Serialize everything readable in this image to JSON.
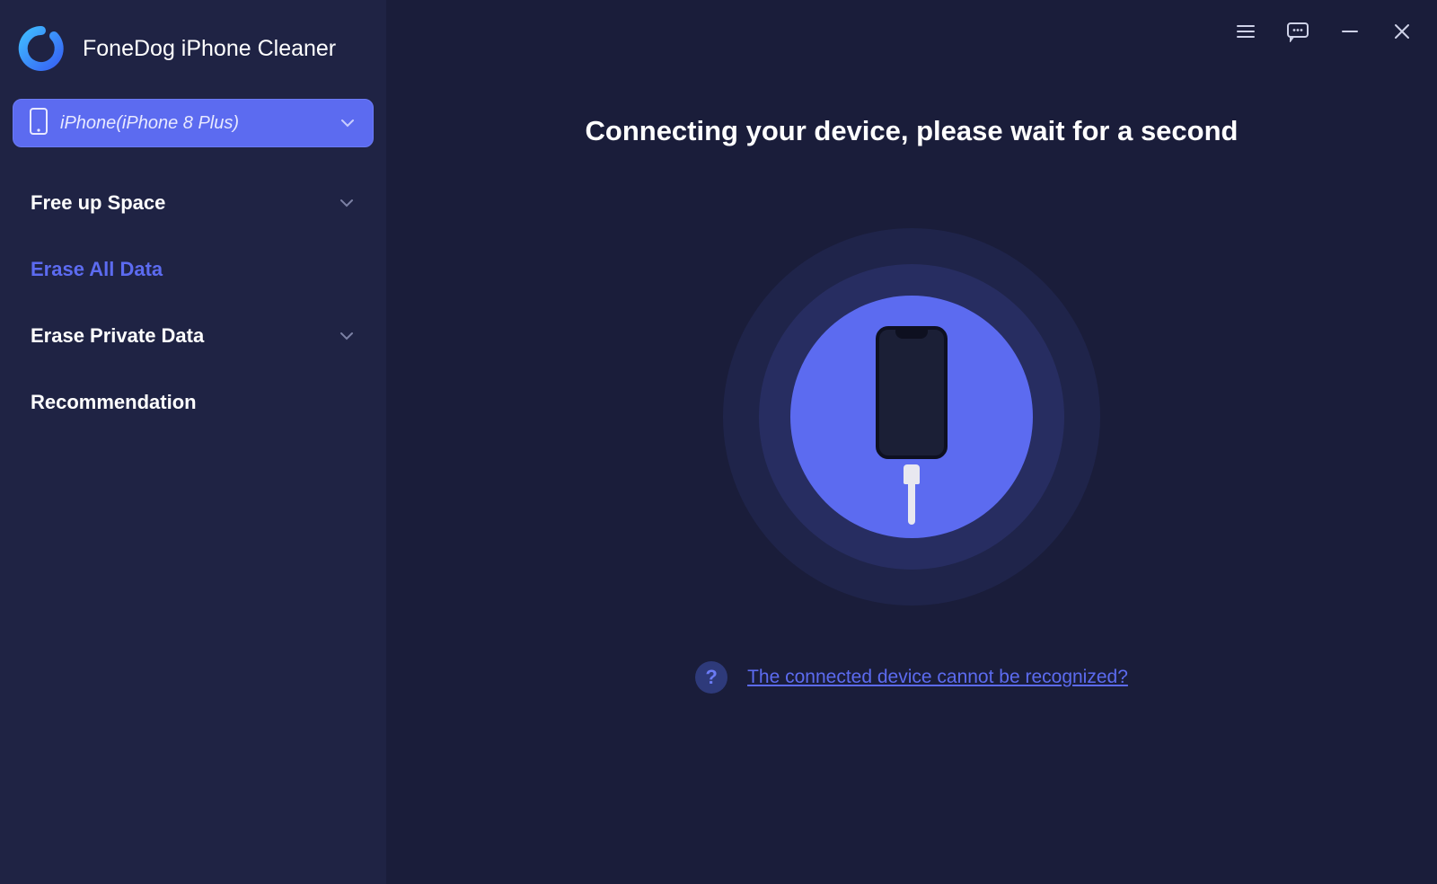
{
  "app": {
    "title": "FoneDog iPhone Cleaner"
  },
  "device": {
    "label": "iPhone(iPhone 8 Plus)"
  },
  "nav": {
    "items": [
      {
        "label": "Free up Space",
        "expandable": true,
        "active": false
      },
      {
        "label": "Erase All Data",
        "expandable": false,
        "active": true
      },
      {
        "label": "Erase Private Data",
        "expandable": true,
        "active": false
      },
      {
        "label": "Recommendation",
        "expandable": false,
        "active": false
      }
    ]
  },
  "main": {
    "heading": "Connecting your device, please wait for a second",
    "help_link": "The connected device cannot be recognized?",
    "help_mark": "?"
  },
  "icons": {
    "menu": "menu-icon",
    "feedback": "feedback-icon",
    "minimize": "minimize-icon",
    "close": "close-icon",
    "chevron": "chevron-down-icon",
    "phone": "phone-icon"
  }
}
